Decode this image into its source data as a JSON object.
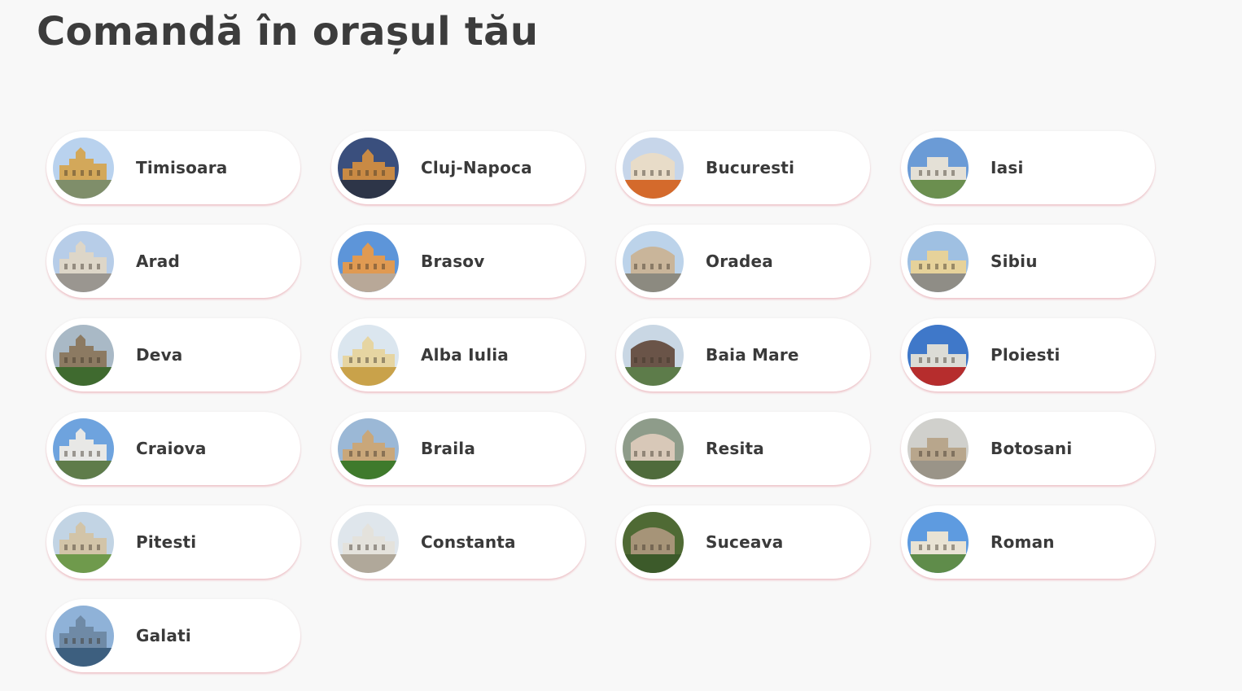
{
  "page": {
    "title": "Comandă în orașul tău"
  },
  "cities": [
    {
      "name": "Timisoara",
      "thumbnail": "cathedral-plaza-photo",
      "sky": "#b9d2ee",
      "building": "#d3a85a",
      "ground": "#7f8e6a"
    },
    {
      "name": "Cluj-Napoca",
      "thumbnail": "night-cityscape-photo",
      "sky": "#3a4f7d",
      "building": "#c98a44",
      "ground": "#2d3548"
    },
    {
      "name": "Bucuresti",
      "thumbnail": "athenaeum-photo",
      "sky": "#c7d6ea",
      "building": "#e8dcc8",
      "ground": "#d46a2c"
    },
    {
      "name": "Iasi",
      "thumbnail": "palace-of-culture-photo",
      "sky": "#6b9bd6",
      "building": "#e4e0d6",
      "ground": "#6b8f4f"
    },
    {
      "name": "Arad",
      "thumbnail": "city-hall-photo",
      "sky": "#b7cde8",
      "building": "#ddd6c8",
      "ground": "#9a9690"
    },
    {
      "name": "Brasov",
      "thumbnail": "council-square-photo",
      "sky": "#5d95d9",
      "building": "#e09a52",
      "ground": "#b8a898"
    },
    {
      "name": "Oradea",
      "thumbnail": "union-square-photo",
      "sky": "#bcd3ea",
      "building": "#c9b59a",
      "ground": "#8c8a80"
    },
    {
      "name": "Sibiu",
      "thumbnail": "grand-square-photo",
      "sky": "#9fc0e2",
      "building": "#e6d29a",
      "ground": "#8f8d86"
    },
    {
      "name": "Deva",
      "thumbnail": "fortress-hill-photo",
      "sky": "#a9b9c6",
      "building": "#8c7a62",
      "ground": "#3f6a2f"
    },
    {
      "name": "Alba Iulia",
      "thumbnail": "cathedral-tower-photo",
      "sky": "#dbe6ef",
      "building": "#e6d5a2",
      "ground": "#c9a24a"
    },
    {
      "name": "Baia Mare",
      "thumbnail": "stephen-tower-photo",
      "sky": "#c9d7e4",
      "building": "#6a5448",
      "ground": "#5d7c4a"
    },
    {
      "name": "Ploiesti",
      "thumbnail": "domed-palace-photo",
      "sky": "#3f78c9",
      "building": "#dcdcd6",
      "ground": "#b62d2d"
    },
    {
      "name": "Craiova",
      "thumbnail": "white-palace-photo",
      "sky": "#6ea3de",
      "building": "#e8e8e6",
      "ground": "#5f7c4a"
    },
    {
      "name": "Braila",
      "thumbnail": "flower-boulevard-photo",
      "sky": "#9bb8d6",
      "building": "#c9a77a",
      "ground": "#3f7a2c"
    },
    {
      "name": "Resita",
      "thumbnail": "aerial-plaza-photo",
      "sky": "#8e9c8a",
      "building": "#d8c8b8",
      "ground": "#4f6b3c"
    },
    {
      "name": "Botosani",
      "thumbnail": "monument-square-photo",
      "sky": "#d0d0cc",
      "building": "#b8a68c",
      "ground": "#9a9488"
    },
    {
      "name": "Pitesti",
      "thumbnail": "park-aerial-photo",
      "sky": "#c2d4e4",
      "building": "#d2c4a8",
      "ground": "#6f9a4c"
    },
    {
      "name": "Constanta",
      "thumbnail": "casino-building-photo",
      "sky": "#dfe6ec",
      "building": "#e4e2dc",
      "ground": "#b0a89a"
    },
    {
      "name": "Suceava",
      "thumbnail": "fortress-aerial-photo",
      "sky": "#4f6a34",
      "building": "#a69478",
      "ground": "#3c5a2a"
    },
    {
      "name": "Roman",
      "thumbnail": "museum-building-photo",
      "sky": "#5e9be0",
      "building": "#e9e3d4",
      "ground": "#5f8c4a"
    },
    {
      "name": "Galati",
      "thumbnail": "danube-cityscape-photo",
      "sky": "#8fb2d8",
      "building": "#6f8aa6",
      "ground": "#3d5f7f"
    }
  ]
}
